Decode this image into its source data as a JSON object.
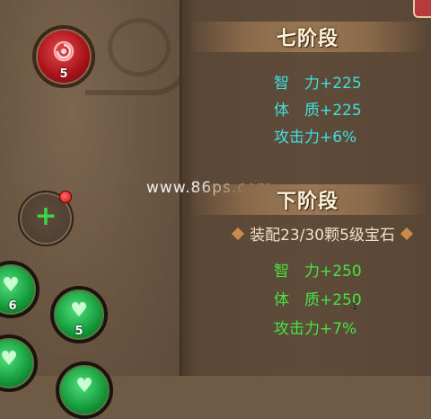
{
  "watermark": "www.86ps.com",
  "stage_seven": {
    "title": "七阶段",
    "stats": [
      "智　力+225",
      "体　质+225",
      "攻击力+6%"
    ]
  },
  "next_stage": {
    "title": "下阶段",
    "requirement": "装配23/30颗5级宝石",
    "stats": [
      "智　力+250",
      "体　质+250",
      "攻击力+7%"
    ]
  },
  "red_orb": {
    "count": "5",
    "icon": "swirl-icon"
  },
  "add_button": {
    "label": "+"
  },
  "gems": [
    {
      "count": "6",
      "icon": "heart-icon"
    },
    {
      "count": "5",
      "icon": "heart-icon"
    },
    {
      "count": "",
      "icon": "heart-icon"
    },
    {
      "count": "",
      "icon": "heart-icon"
    }
  ],
  "small_mark": "1",
  "colors": {
    "stage_seven_stats": "#3fe0e0",
    "next_stage_stats": "#45e545",
    "title_text": "#fff3dc"
  }
}
